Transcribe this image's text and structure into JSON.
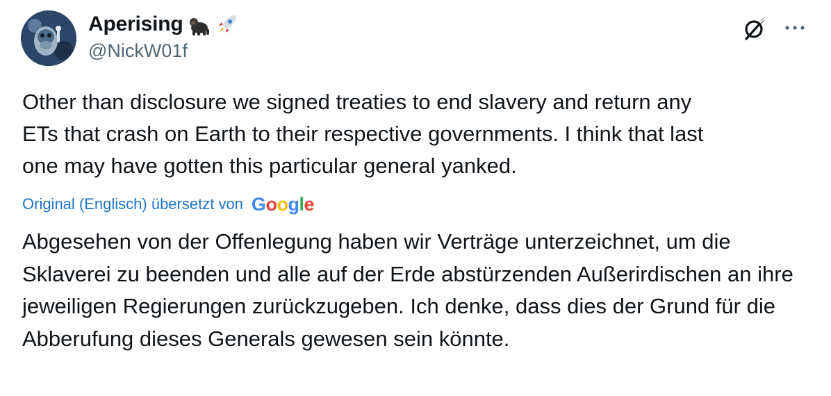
{
  "author": {
    "display_name": "Aperising",
    "emoji": [
      "gorilla-icon",
      "rocket-icon"
    ],
    "handle": "@NickW01f"
  },
  "header_icons": [
    "grok-icon",
    "more-options-icon"
  ],
  "tweet": {
    "text": "Other than disclosure we signed treaties to end slavery and return any\nETs that crash on Earth to their respective governments. I think that last\none may have gotten this particular general yanked."
  },
  "translation": {
    "label": "Original (Englisch) übersetzt von",
    "provider_letters": [
      {
        "ch": "G",
        "color": "#4285F4"
      },
      {
        "ch": "o",
        "color": "#EA4335"
      },
      {
        "ch": "o",
        "color": "#FBBC05"
      },
      {
        "ch": "g",
        "color": "#4285F4"
      },
      {
        "ch": "l",
        "color": "#34A853"
      },
      {
        "ch": "e",
        "color": "#EA4335"
      }
    ],
    "text": "Abgesehen von der Offenlegung haben wir Verträge unterzeichnet, um die Sklaverei zu beenden und alle auf der Erde abstürzenden Außerirdischen an ihre jeweiligen Regierungen zurückzugeben. Ich denke, dass dies der Grund für die Abberufung dieses Generals gewesen sein könnte."
  },
  "colors": {
    "text": "#0f1419",
    "secondary": "#536471",
    "link": "#1d75c9"
  }
}
